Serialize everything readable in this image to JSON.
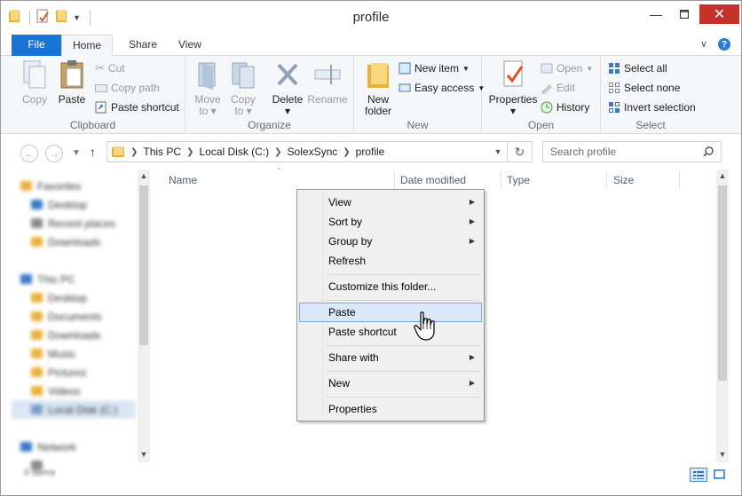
{
  "window": {
    "title": "profile"
  },
  "ribbon_tabs": {
    "file": "File",
    "home": "Home",
    "share": "Share",
    "view": "View"
  },
  "ribbon": {
    "clipboard": {
      "copy": "Copy",
      "paste": "Paste",
      "cut": "Cut",
      "copy_path": "Copy path",
      "paste_shortcut": "Paste shortcut",
      "label": "Clipboard"
    },
    "organize": {
      "move_to_1": "Move",
      "move_to_2": "to",
      "copy_to_1": "Copy",
      "copy_to_2": "to",
      "delete": "Delete",
      "rename": "Rename",
      "label": "Organize"
    },
    "new": {
      "new_folder_1": "New",
      "new_folder_2": "folder",
      "new_item": "New item",
      "easy_access": "Easy access",
      "label": "New"
    },
    "open": {
      "properties": "Properties",
      "open": "Open",
      "edit": "Edit",
      "history": "History",
      "label": "Open"
    },
    "select": {
      "select_all": "Select all",
      "select_none": "Select none",
      "invert_selection": "Invert selection",
      "label": "Select"
    }
  },
  "address": {
    "crumbs": [
      "This PC",
      "Local Disk (C:)",
      "SolexSync",
      "profile"
    ]
  },
  "search": {
    "placeholder": "Search profile"
  },
  "navpane": {
    "items": [
      {
        "label": "Favorites",
        "indent": 0,
        "color": "#e8b23a"
      },
      {
        "label": "Desktop",
        "indent": 1,
        "color": "#3a78c8"
      },
      {
        "label": "Recent places",
        "indent": 1,
        "color": "#8a8a8a"
      },
      {
        "label": "Downloads",
        "indent": 1,
        "color": "#e8b23a"
      },
      {
        "label": "",
        "indent": 0,
        "color": "transparent"
      },
      {
        "label": "This PC",
        "indent": 0,
        "color": "#3a78c8"
      },
      {
        "label": "Desktop",
        "indent": 1,
        "color": "#e8b23a"
      },
      {
        "label": "Documents",
        "indent": 1,
        "color": "#e8b23a"
      },
      {
        "label": "Downloads",
        "indent": 1,
        "color": "#e8b23a"
      },
      {
        "label": "Music",
        "indent": 1,
        "color": "#e8b23a"
      },
      {
        "label": "Pictures",
        "indent": 1,
        "color": "#e8b23a"
      },
      {
        "label": "Videos",
        "indent": 1,
        "color": "#e8b23a"
      },
      {
        "label": "Local Disk (C:)",
        "indent": 1,
        "color": "#7aa0c8",
        "selected": true
      },
      {
        "label": "",
        "indent": 0,
        "color": "transparent"
      },
      {
        "label": "Network",
        "indent": 0,
        "color": "#3a78c8"
      },
      {
        "label": "",
        "indent": 1,
        "color": "#8a8a8a"
      }
    ],
    "status": "0 items"
  },
  "columns": {
    "name": "Name",
    "date_modified": "Date modified",
    "type": "Type",
    "size": "Size"
  },
  "context_menu": {
    "view": "View",
    "sort_by": "Sort by",
    "group_by": "Group by",
    "refresh": "Refresh",
    "customize": "Customize this folder...",
    "paste": "Paste",
    "paste_shortcut": "Paste shortcut",
    "share_with": "Share with",
    "new": "New",
    "properties": "Properties"
  },
  "colors": {
    "accent": "#1a74d3",
    "close": "#c7312b",
    "highlight": "#dbe8f7"
  }
}
